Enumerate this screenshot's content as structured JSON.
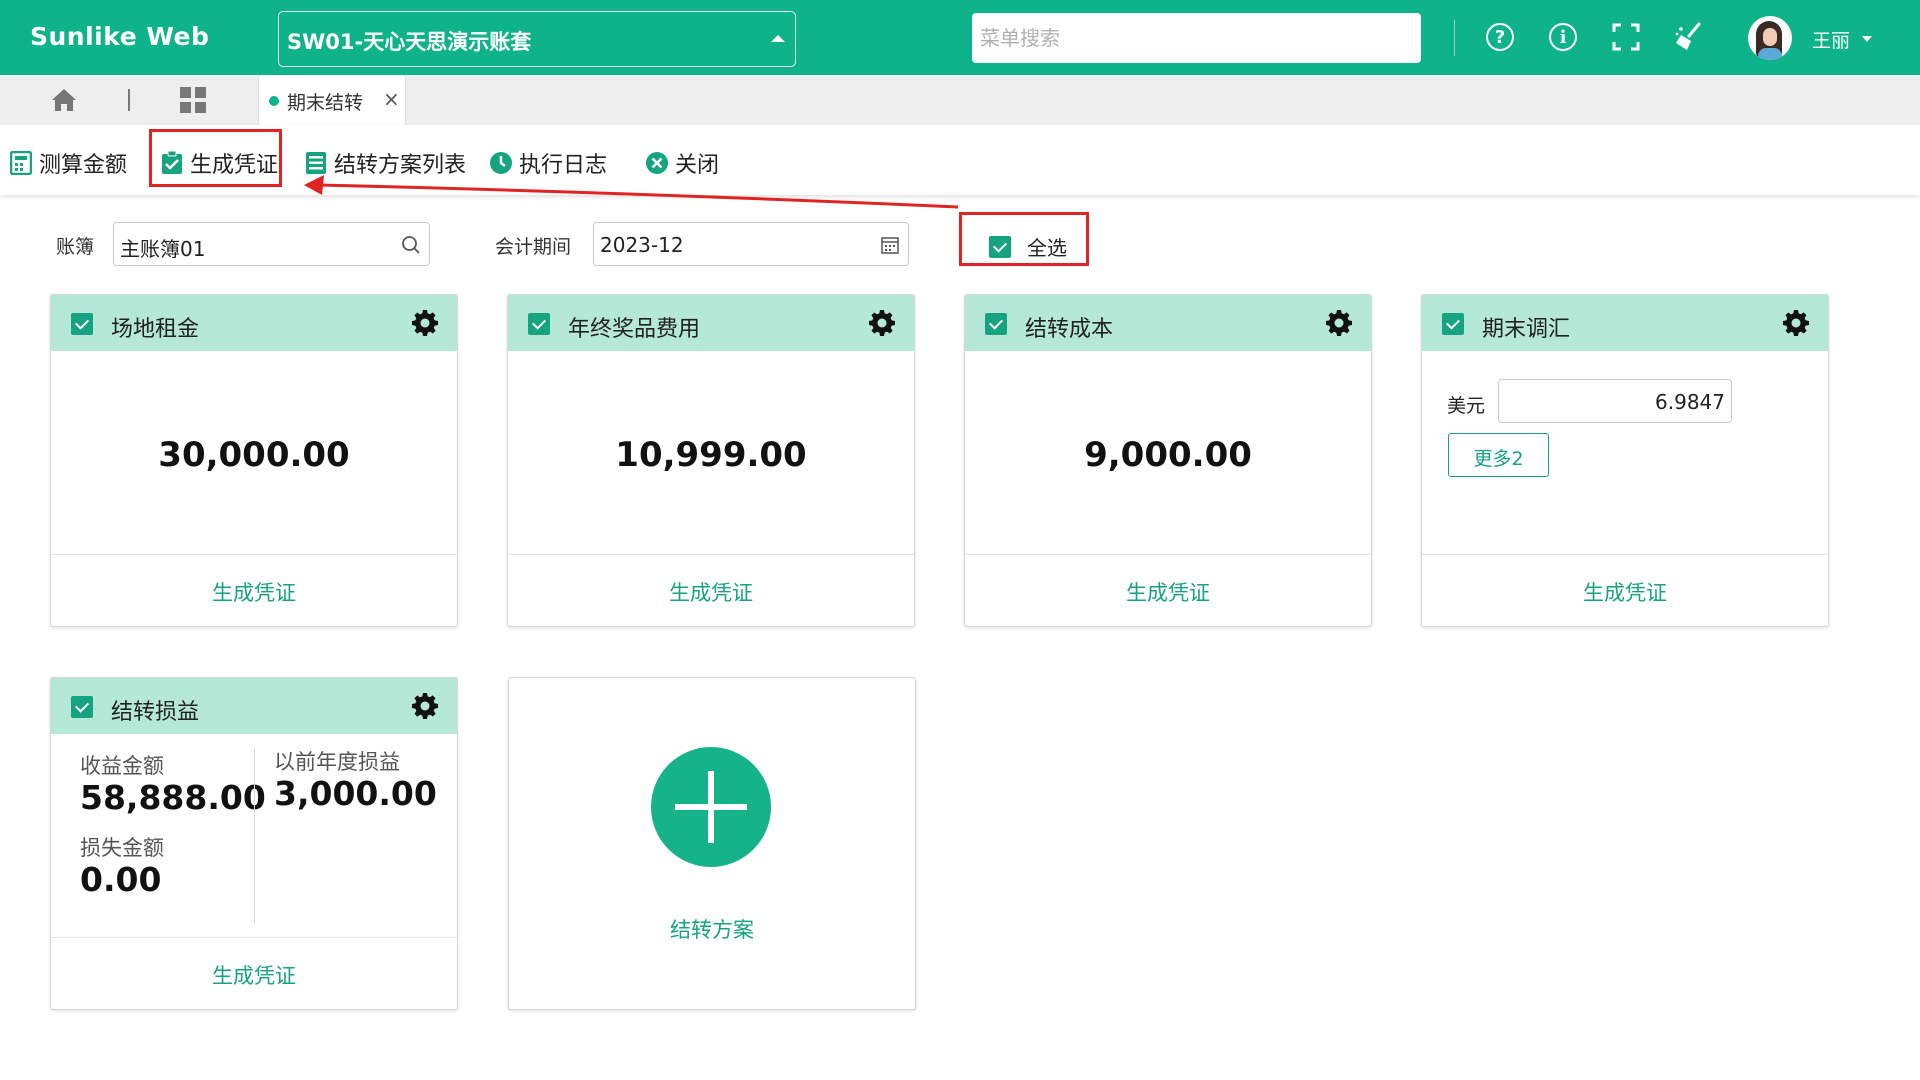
{
  "header": {
    "brand": "Sunlike Web",
    "account_set": "SW01-天心天思演示账套",
    "menu_search_placeholder": "菜单搜索",
    "help_icon_glyph": "?",
    "info_icon_glyph": "i",
    "username": "王丽"
  },
  "tabs": {
    "active_label": "期末结转",
    "close_glyph": "×"
  },
  "toolbar": {
    "calc_label": "测算金额",
    "gen_label": "生成凭证",
    "plan_list_label": "结转方案列表",
    "log_label": "执行日志",
    "close_label": "关闭"
  },
  "filters": {
    "ledger_label": "账簿",
    "ledger_value": "主账簿01",
    "period_label": "会计期间",
    "period_value": "2023-12",
    "select_all_label": "全选"
  },
  "cards": {
    "rent": {
      "title": "场地租金",
      "amount": "30,000.00",
      "action": "生成凭证"
    },
    "bonus": {
      "title": "年终奖品费用",
      "amount": "10,999.00",
      "action": "生成凭证"
    },
    "cost": {
      "title": "结转成本",
      "amount": "9,000.00",
      "action": "生成凭证"
    },
    "fx": {
      "title": "期末调汇",
      "currency_label": "美元",
      "rate": "6.9847",
      "more_label": "更多2",
      "action": "生成凭证"
    },
    "pl": {
      "title": "结转损益",
      "income_label": "收益金额",
      "income_value": "58,888.00",
      "prior_label": "以前年度损益",
      "prior_value": "3,000.00",
      "loss_label": "损失金额",
      "loss_value": "0.00",
      "action": "生成凭证"
    },
    "add": {
      "label": "结转方案"
    }
  },
  "colors": {
    "brand_green": "#0fb389",
    "card_header": "#b5e8d7",
    "link_green": "#16a37f",
    "highlight_red": "#e02424"
  }
}
